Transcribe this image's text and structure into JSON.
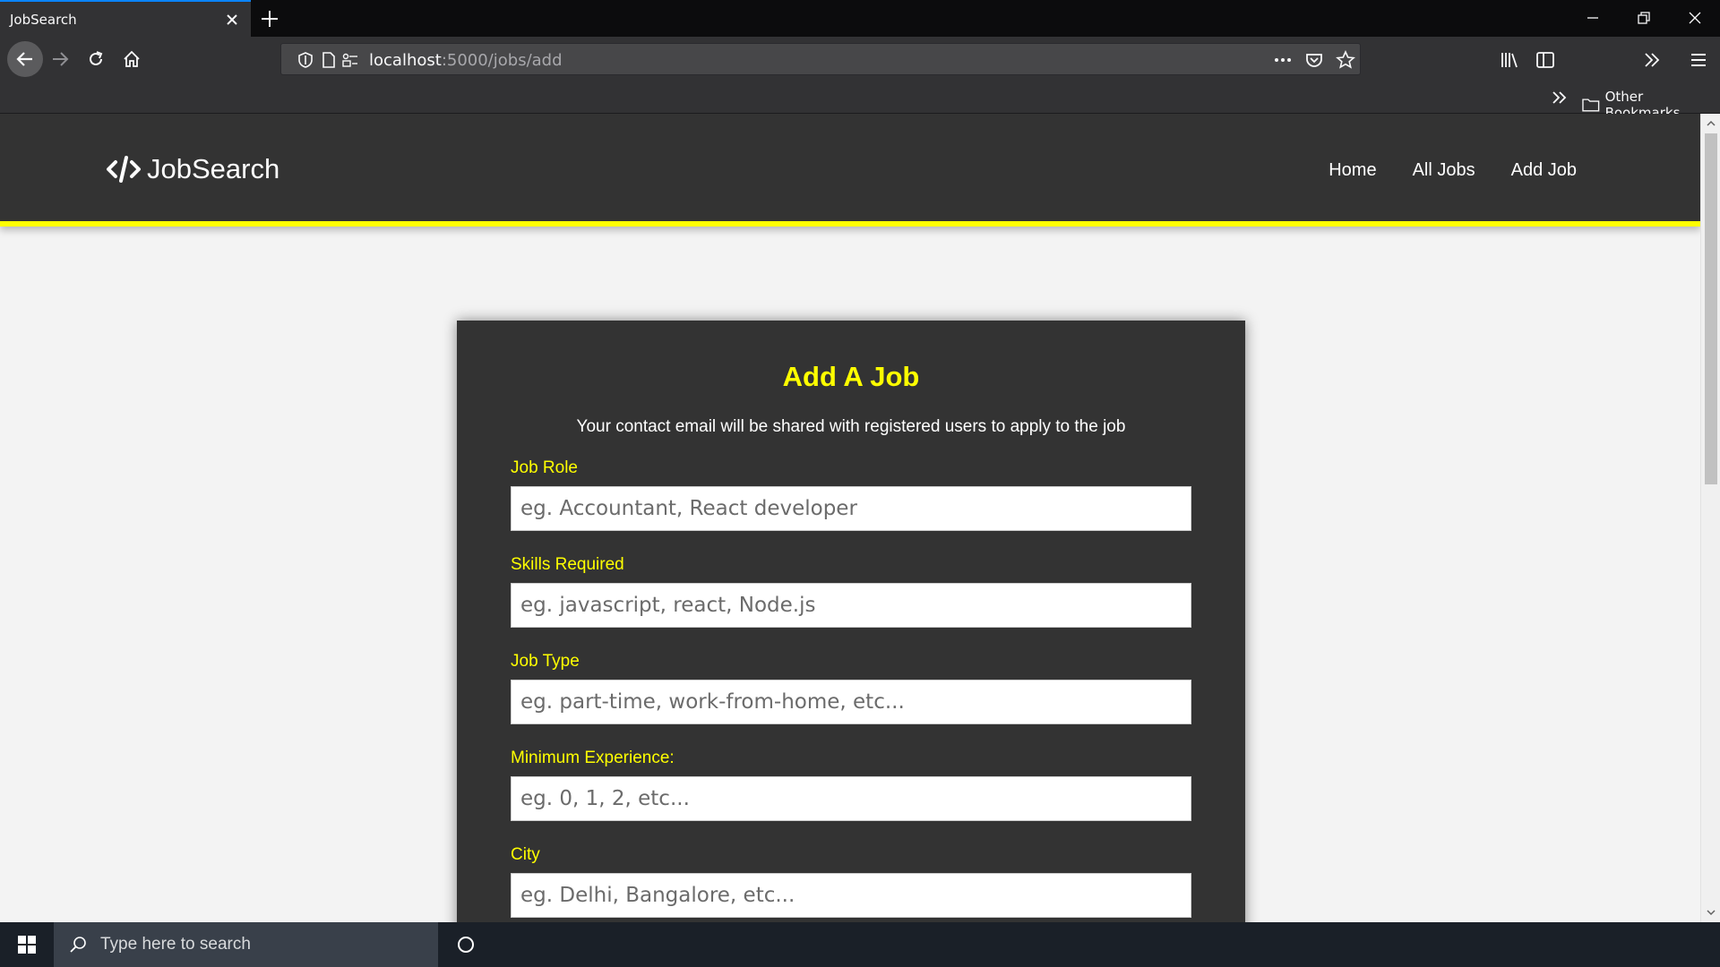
{
  "browser": {
    "tab_title": "JobSearch",
    "url_host": "localhost",
    "url_path": ":5000/jobs/add",
    "bookmarks_folder": "Other Bookmarks"
  },
  "site": {
    "logo_text": "JobSearch",
    "nav": [
      "Home",
      "All Jobs",
      "Add Job"
    ]
  },
  "form": {
    "title": "Add A Job",
    "subtitle": "Your contact email will be shared with registered users to apply to the job",
    "fields": [
      {
        "label": "Job Role",
        "placeholder": "eg. Accountant, React developer"
      },
      {
        "label": "Skills Required",
        "placeholder": "eg. javascript, react, Node.js"
      },
      {
        "label": "Job Type",
        "placeholder": "eg. part-time, work-from-home, etc..."
      },
      {
        "label": "Minimum Experience:",
        "placeholder": "eg. 0, 1, 2, etc..."
      },
      {
        "label": "City",
        "placeholder": "eg. Delhi, Bangalore, etc..."
      }
    ]
  },
  "taskbar": {
    "search_placeholder": "Type here to search"
  },
  "colors": {
    "accent": "#ffff00",
    "header_bg": "#333333",
    "browser_tab_highlight": "#0a84ff"
  }
}
